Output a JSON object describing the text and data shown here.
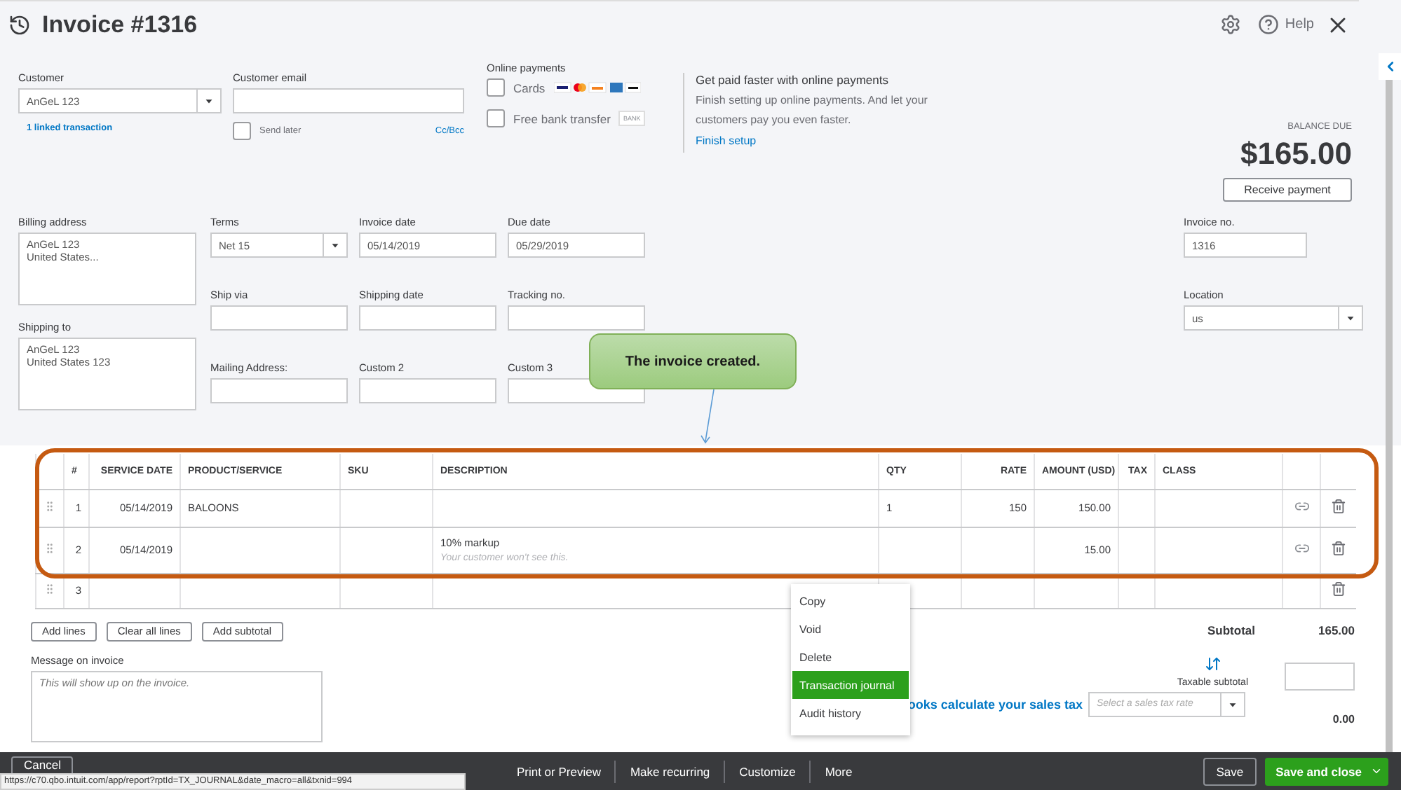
{
  "header": {
    "title": "Invoice #1316",
    "help": "Help"
  },
  "customer": {
    "label": "Customer",
    "value": "AnGeL 123",
    "link": "1 linked transaction"
  },
  "email": {
    "label": "Customer email",
    "send_later_label": "Send later",
    "send_later": false,
    "cc_bcc": "Cc/Bcc"
  },
  "online_payments": {
    "title": "Online payments",
    "options": [
      {
        "kind": "cards",
        "label": "Cards",
        "checked": false
      },
      {
        "kind": "bank",
        "label": "Free bank transfer",
        "checked": false,
        "badge": "BANK"
      }
    ]
  },
  "promo": {
    "title": "Get paid faster with online payments",
    "text": "Finish setting up online payments. And let your customers pay you even faster.",
    "link": "Finish setup"
  },
  "balance": {
    "label": "BALANCE DUE",
    "amount": "$165.00",
    "button": "Receive payment"
  },
  "billing_address": {
    "label": "Billing address",
    "lines": [
      "AnGeL 123",
      "United States..."
    ]
  },
  "shipping_to": {
    "label": "Shipping to",
    "lines": [
      "AnGeL 123",
      "United States 123"
    ]
  },
  "fields": [
    {
      "kind": "select",
      "label": "Terms",
      "value": "Net 15"
    },
    {
      "kind": "text",
      "label": "Invoice date",
      "value": "05/14/2019"
    },
    {
      "kind": "text",
      "label": "Due date",
      "value": "05/29/2019"
    },
    {
      "kind": "text",
      "label": "Ship via"
    },
    {
      "kind": "text",
      "label": "Shipping date"
    },
    {
      "kind": "text",
      "label": "Tracking no."
    },
    {
      "kind": "text",
      "label": "Mailing Address:"
    },
    {
      "kind": "text",
      "label": "Custom 2"
    },
    {
      "kind": "text",
      "label": "Custom 3"
    }
  ],
  "invoice_no": {
    "label": "Invoice no.",
    "value": "1316"
  },
  "location": {
    "label": "Location",
    "value": "us"
  },
  "callout": "The invoice created.",
  "table": {
    "columns": [
      "#",
      "SERVICE DATE",
      "PRODUCT/SERVICE",
      "SKU",
      "DESCRIPTION",
      "QTY",
      "RATE",
      "AMOUNT (USD)",
      "TAX",
      "CLASS"
    ],
    "rows": [
      {
        "kind": "line",
        "num": "1",
        "date": "05/14/2019",
        "product": "BALOONS",
        "description": "",
        "note": "",
        "qty": "1",
        "rate": "150",
        "amount": "150.00"
      },
      {
        "kind": "line",
        "num": "2",
        "date": "05/14/2019",
        "product": "",
        "description": "10% markup",
        "note": "Your customer won't see this.",
        "qty": "",
        "rate": "",
        "amount": "15.00"
      },
      {
        "kind": "blank",
        "num": "3",
        "date": "",
        "product": "",
        "description": "",
        "note": "",
        "qty": "",
        "rate": "",
        "amount": ""
      }
    ]
  },
  "line_buttons": [
    "Add lines",
    "Clear all lines",
    "Add subtotal"
  ],
  "message": {
    "label": "Message on invoice",
    "placeholder": "This will show up on the invoice."
  },
  "subtotal": {
    "label": "Subtotal",
    "value": "165.00"
  },
  "taxable": {
    "label": "Taxable subtotal"
  },
  "sales_tax": {
    "prompt": "ooks calculate your sales tax",
    "placeholder": "Select a sales tax rate"
  },
  "total_partial": "0.00",
  "menu": [
    {
      "label": "Copy",
      "selected": false
    },
    {
      "label": "Void",
      "selected": false
    },
    {
      "label": "Delete",
      "selected": false
    },
    {
      "label": "Transaction journal",
      "selected": true
    },
    {
      "label": "Audit history",
      "selected": false
    }
  ],
  "footer": {
    "cancel": "Cancel",
    "actions": [
      "Print or Preview",
      "Make recurring",
      "Customize",
      "More"
    ],
    "save": "Save",
    "save_close": "Save and close"
  },
  "status_url": "https://c70.qbo.intuit.com/app/report?rptId=TX_JOURNAL&date_macro=all&txnid=994"
}
